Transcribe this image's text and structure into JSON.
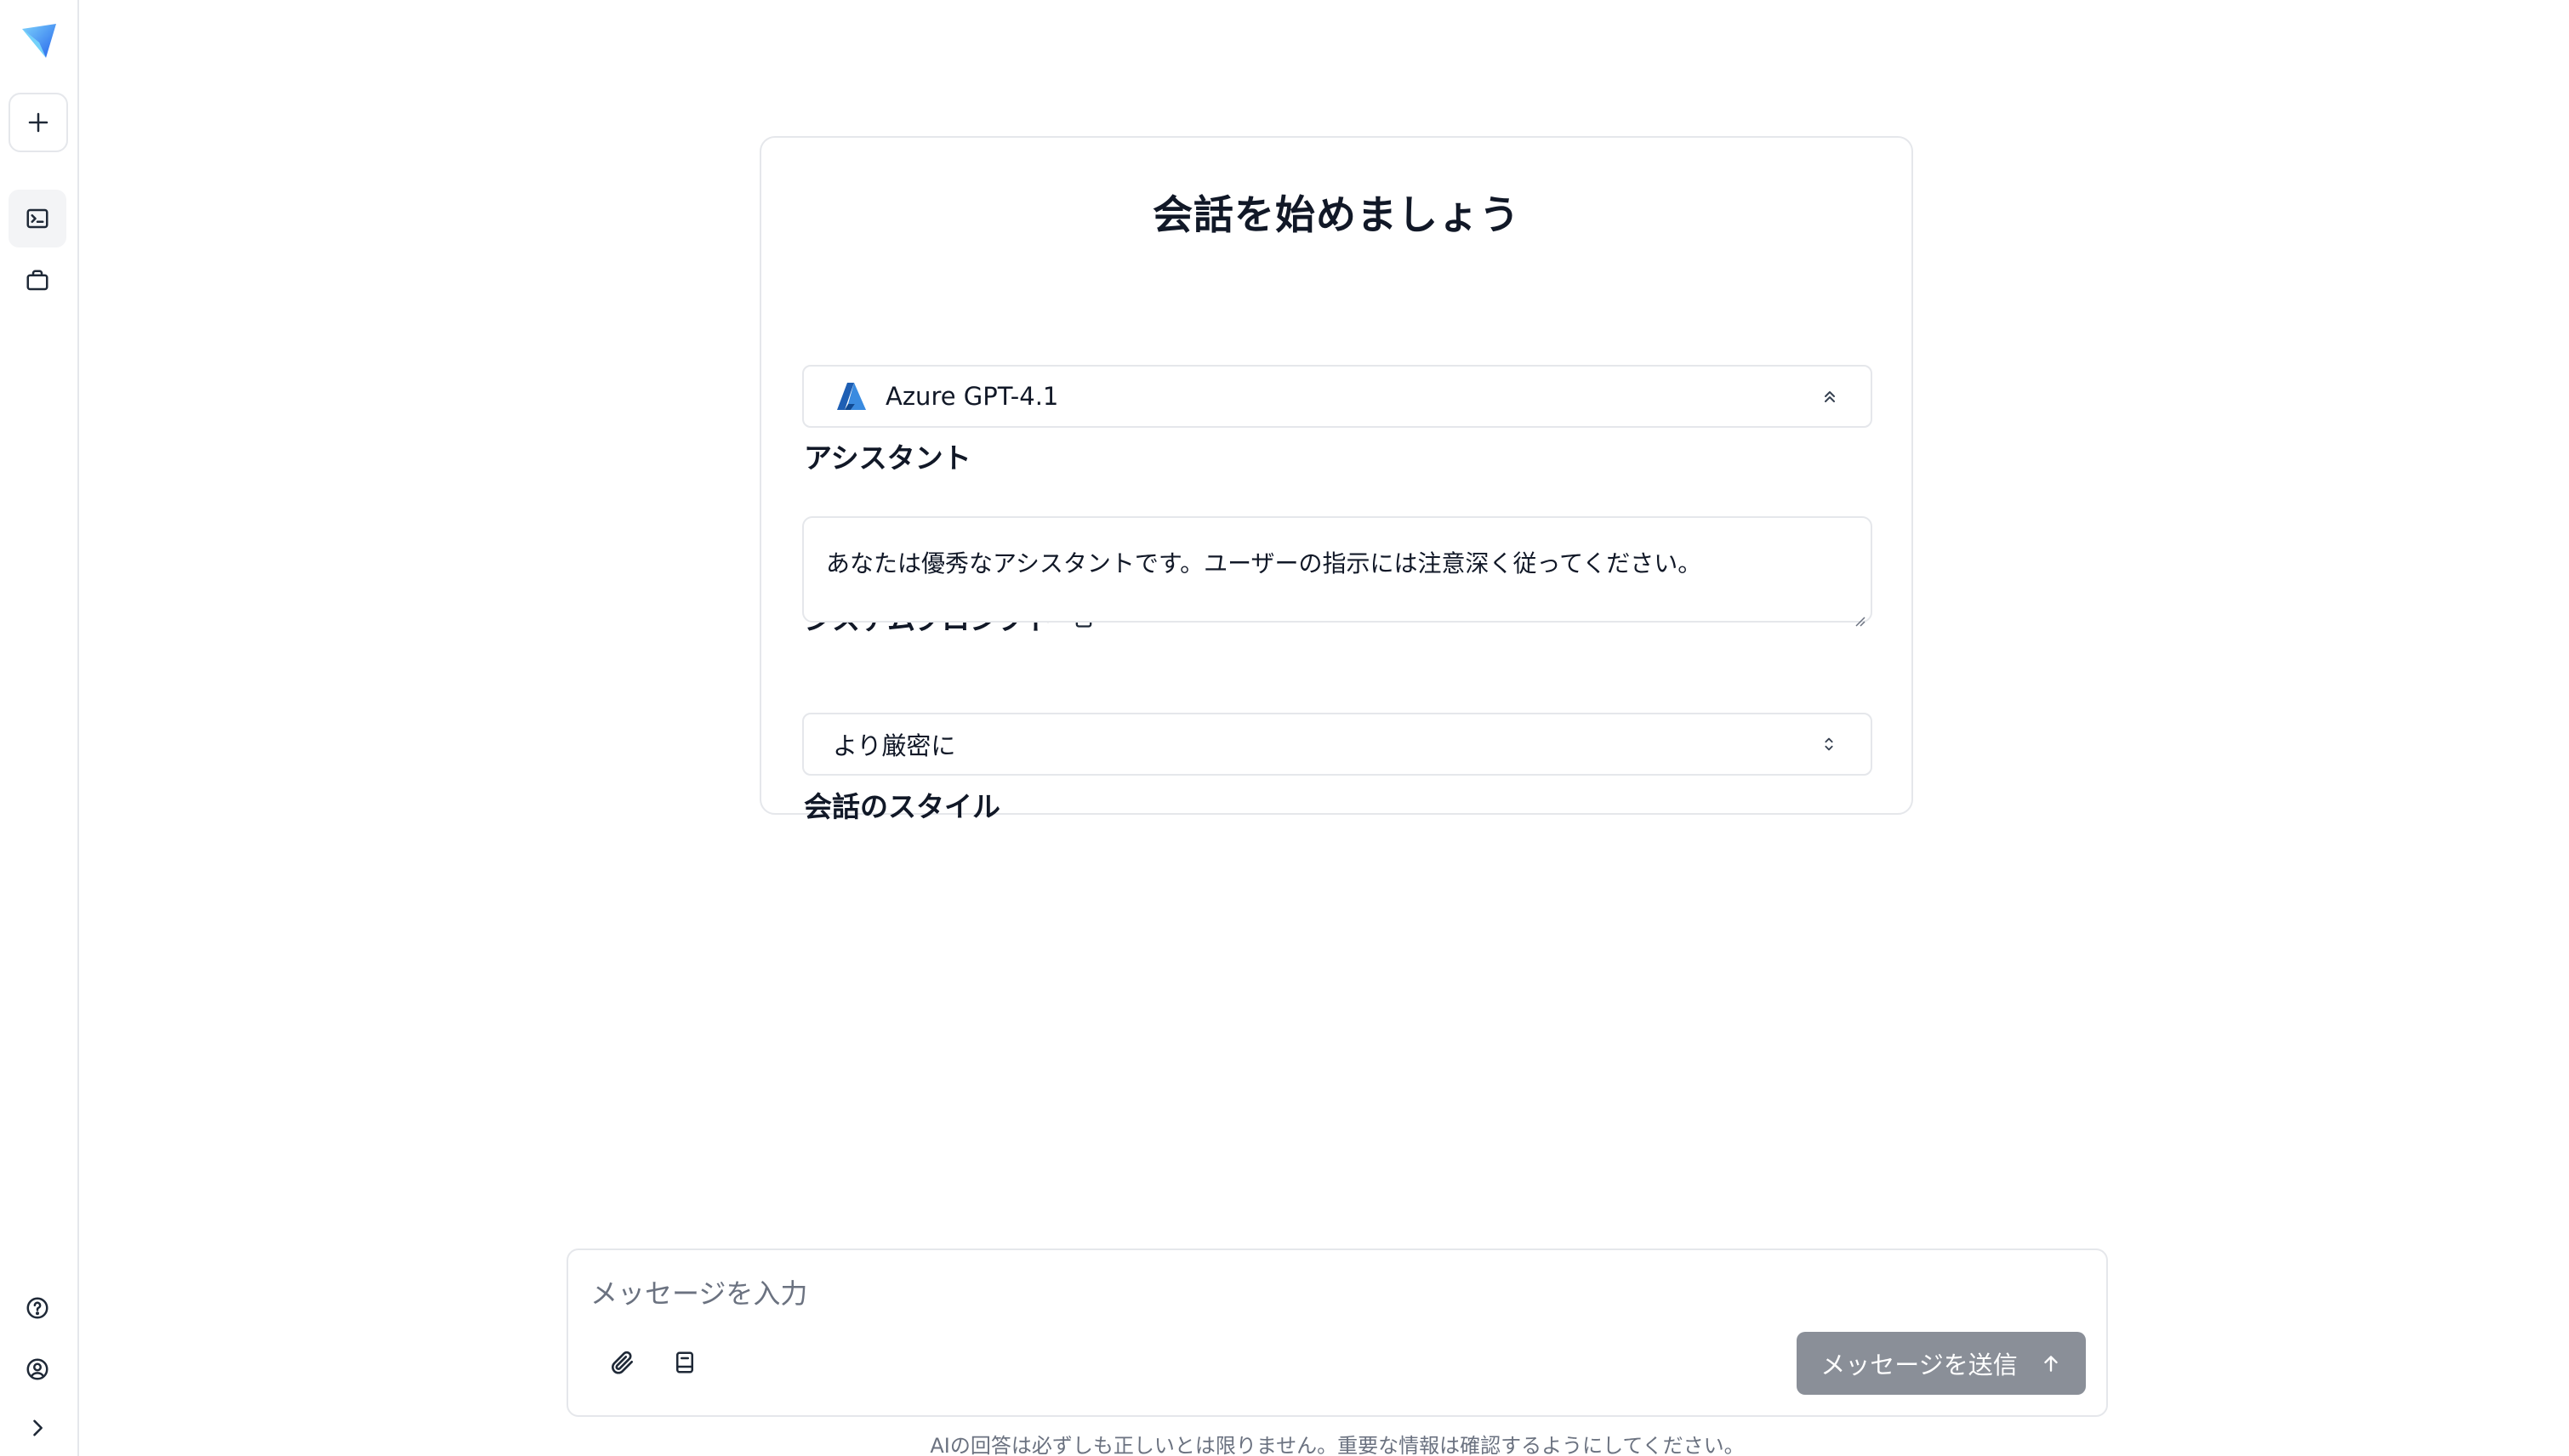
{
  "sidebar": {
    "logo": "app-logo",
    "new_chat_icon": "plus-icon",
    "chat_icon": "terminal-icon",
    "workspace_icon": "briefcase-icon",
    "help_icon": "help-circle-icon",
    "user_icon": "user-circle-icon",
    "expand_icon": "chevron-right-icon"
  },
  "card": {
    "title": "会話を始めましょう",
    "assistant_label": "アシスタント",
    "assistant_value": "Azure GPT-4.1",
    "system_prompt_label": "システムプロンプト",
    "system_prompt_value": "あなたは優秀なアシスタントです。ユーザーの指示には注意深く従ってください。",
    "style_label": "会話のスタイル",
    "style_value": "より厳密に"
  },
  "composer": {
    "placeholder": "メッセージを入力",
    "send_label": "メッセージを送信",
    "attach_icon": "paperclip-icon",
    "prompt_library_icon": "book-icon",
    "send_icon": "arrow-up-icon"
  },
  "footer": {
    "disclaimer": "AIの回答は必ずしも正しいとは限りません。重要な情報は確認するようにしてください。"
  },
  "colors": {
    "border": "#e5e7eb",
    "send_button": "#8a8f98",
    "muted_text": "#6b7280",
    "active_sidebar": "#f3f4f6"
  }
}
